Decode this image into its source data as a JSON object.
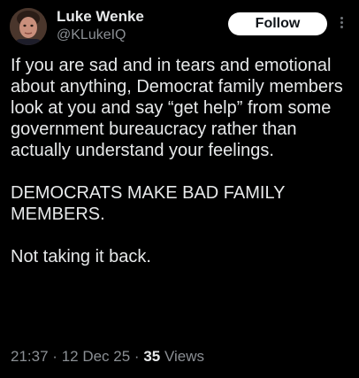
{
  "author": {
    "display_name": "Luke Wenke",
    "handle": "@KLukeIQ"
  },
  "actions": {
    "follow_label": "Follow",
    "more_icon": "more-vertical-icon"
  },
  "tweet": {
    "paragraphs": [
      "If you are sad and in tears and emotional about anything, Democrat family members look at you and say “get help” from some government bureaucracy rather than actually understand your feelings.",
      "DEMOCRATS MAKE BAD FAMILY MEMBERS.",
      "Not taking it back."
    ]
  },
  "meta": {
    "time": "21:37",
    "separator": "·",
    "date": "12 Dec 25",
    "views_count": "35",
    "views_label": "Views"
  },
  "colors": {
    "background": "#000000",
    "text_primary": "#e7e9ea",
    "text_secondary": "#8b8f94",
    "follow_bg": "#ffffff",
    "follow_text": "#0f1419"
  }
}
